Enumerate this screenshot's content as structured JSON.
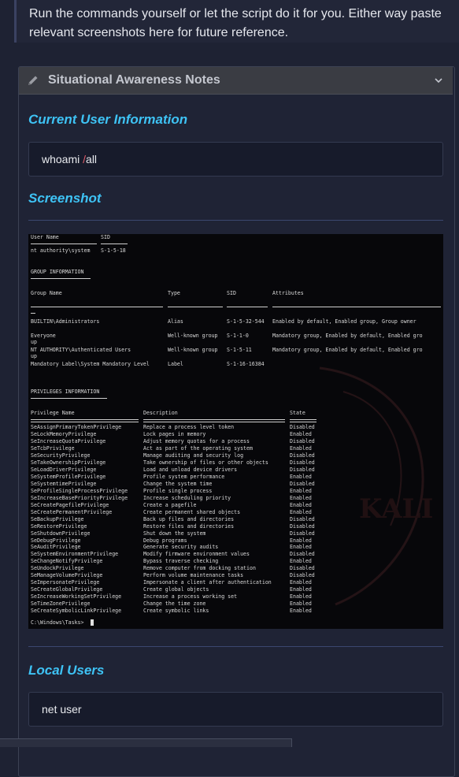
{
  "callout": {
    "text": "Run the commands yourself or let the script do it for you. Either way paste relevant screenshots here for future reference."
  },
  "panel": {
    "title": "Situational Awareness Notes",
    "icons": {
      "edit": "pencil-icon",
      "toggle": "chevron-down-icon"
    }
  },
  "sections": {
    "current_user": {
      "heading": "Current User Information",
      "cmd_a": "whoami ",
      "cmd_slash": "/",
      "cmd_b": "all"
    },
    "screenshot": {
      "heading": "Screenshot"
    },
    "local_users": {
      "heading": "Local Users",
      "cmd": "net user"
    }
  },
  "terminal": {
    "user_header": {
      "user_name": "User Name",
      "sid": "SID"
    },
    "user_row": {
      "name": "nt authority\\system",
      "sid": "S-1-5-18"
    },
    "group_title": "GROUP INFORMATION",
    "group_headers": {
      "name": "Group Name",
      "type": "Type",
      "sid": "SID",
      "attributes": "Attributes"
    },
    "groups": [
      {
        "name": "BUILTIN\\Administrators",
        "type": "Alias",
        "sid": "S-1-5-32-544",
        "attr": "Enabled by default, Enabled group, Group owner",
        "wrap": ""
      },
      {
        "name": "Everyone",
        "type": "Well-known group",
        "sid": "S-1-1-0",
        "attr": "Mandatory group, Enabled by default, Enabled gro",
        "wrap": "up"
      },
      {
        "name": "NT AUTHORITY\\Authenticated Users",
        "type": "Well-known group",
        "sid": "S-1-5-11",
        "attr": "Mandatory group, Enabled by default, Enabled gro",
        "wrap": "up"
      },
      {
        "name": "Mandatory Label\\System Mandatory Level",
        "type": "Label",
        "sid": "S-1-16-16384",
        "attr": "",
        "wrap": ""
      }
    ],
    "priv_title": "PRIVILEGES INFORMATION",
    "priv_headers": {
      "name": "Privilege Name",
      "desc": "Description",
      "state": "State"
    },
    "privileges": [
      {
        "name": "SeAssignPrimaryTokenPrivilege",
        "desc": "Replace a process level token",
        "state": "Disabled"
      },
      {
        "name": "SeLockMemoryPrivilege",
        "desc": "Lock pages in memory",
        "state": "Enabled"
      },
      {
        "name": "SeIncreaseQuotaPrivilege",
        "desc": "Adjust memory quotas for a process",
        "state": "Disabled"
      },
      {
        "name": "SeTcbPrivilege",
        "desc": "Act as part of the operating system",
        "state": "Enabled"
      },
      {
        "name": "SeSecurityPrivilege",
        "desc": "Manage auditing and security log",
        "state": "Disabled"
      },
      {
        "name": "SeTakeOwnershipPrivilege",
        "desc": "Take ownership of files or other objects",
        "state": "Disabled"
      },
      {
        "name": "SeLoadDriverPrivilege",
        "desc": "Load and unload device drivers",
        "state": "Disabled"
      },
      {
        "name": "SeSystemProfilePrivilege",
        "desc": "Profile system performance",
        "state": "Enabled"
      },
      {
        "name": "SeSystemtimePrivilege",
        "desc": "Change the system time",
        "state": "Disabled"
      },
      {
        "name": "SeProfileSingleProcessPrivilege",
        "desc": "Profile single process",
        "state": "Enabled"
      },
      {
        "name": "SeIncreaseBasePriorityPrivilege",
        "desc": "Increase scheduling priority",
        "state": "Enabled"
      },
      {
        "name": "SeCreatePagefilePrivilege",
        "desc": "Create a pagefile",
        "state": "Enabled"
      },
      {
        "name": "SeCreatePermanentPrivilege",
        "desc": "Create permanent shared objects",
        "state": "Enabled"
      },
      {
        "name": "SeBackupPrivilege",
        "desc": "Back up files and directories",
        "state": "Disabled"
      },
      {
        "name": "SeRestorePrivilege",
        "desc": "Restore files and directories",
        "state": "Disabled"
      },
      {
        "name": "SeShutdownPrivilege",
        "desc": "Shut down the system",
        "state": "Disabled"
      },
      {
        "name": "SeDebugPrivilege",
        "desc": "Debug programs",
        "state": "Enabled"
      },
      {
        "name": "SeAuditPrivilege",
        "desc": "Generate security audits",
        "state": "Enabled"
      },
      {
        "name": "SeSystemEnvironmentPrivilege",
        "desc": "Modify firmware environment values",
        "state": "Disabled"
      },
      {
        "name": "SeChangeNotifyPrivilege",
        "desc": "Bypass traverse checking",
        "state": "Enabled"
      },
      {
        "name": "SeUndockPrivilege",
        "desc": "Remove computer from docking station",
        "state": "Disabled"
      },
      {
        "name": "SeManageVolumePrivilege",
        "desc": "Perform volume maintenance tasks",
        "state": "Disabled"
      },
      {
        "name": "SeImpersonatePrivilege",
        "desc": "Impersonate a client after authentication",
        "state": "Enabled"
      },
      {
        "name": "SeCreateGlobalPrivilege",
        "desc": "Create global objects",
        "state": "Enabled"
      },
      {
        "name": "SeIncreaseWorkingSetPrivilege",
        "desc": "Increase a process working set",
        "state": "Enabled"
      },
      {
        "name": "SeTimeZonePrivilege",
        "desc": "Change the time zone",
        "state": "Enabled"
      },
      {
        "name": "SeCreateSymbolicLinkPrivilege",
        "desc": "Create symbolic links",
        "state": "Enabled"
      }
    ],
    "prompt": "C:\\Windows\\Tasks>"
  },
  "colors": {
    "heading": "#3ec3f5",
    "background": "#1e2233",
    "panel_header": "#3a3c43",
    "slash": "#e35d6a"
  }
}
